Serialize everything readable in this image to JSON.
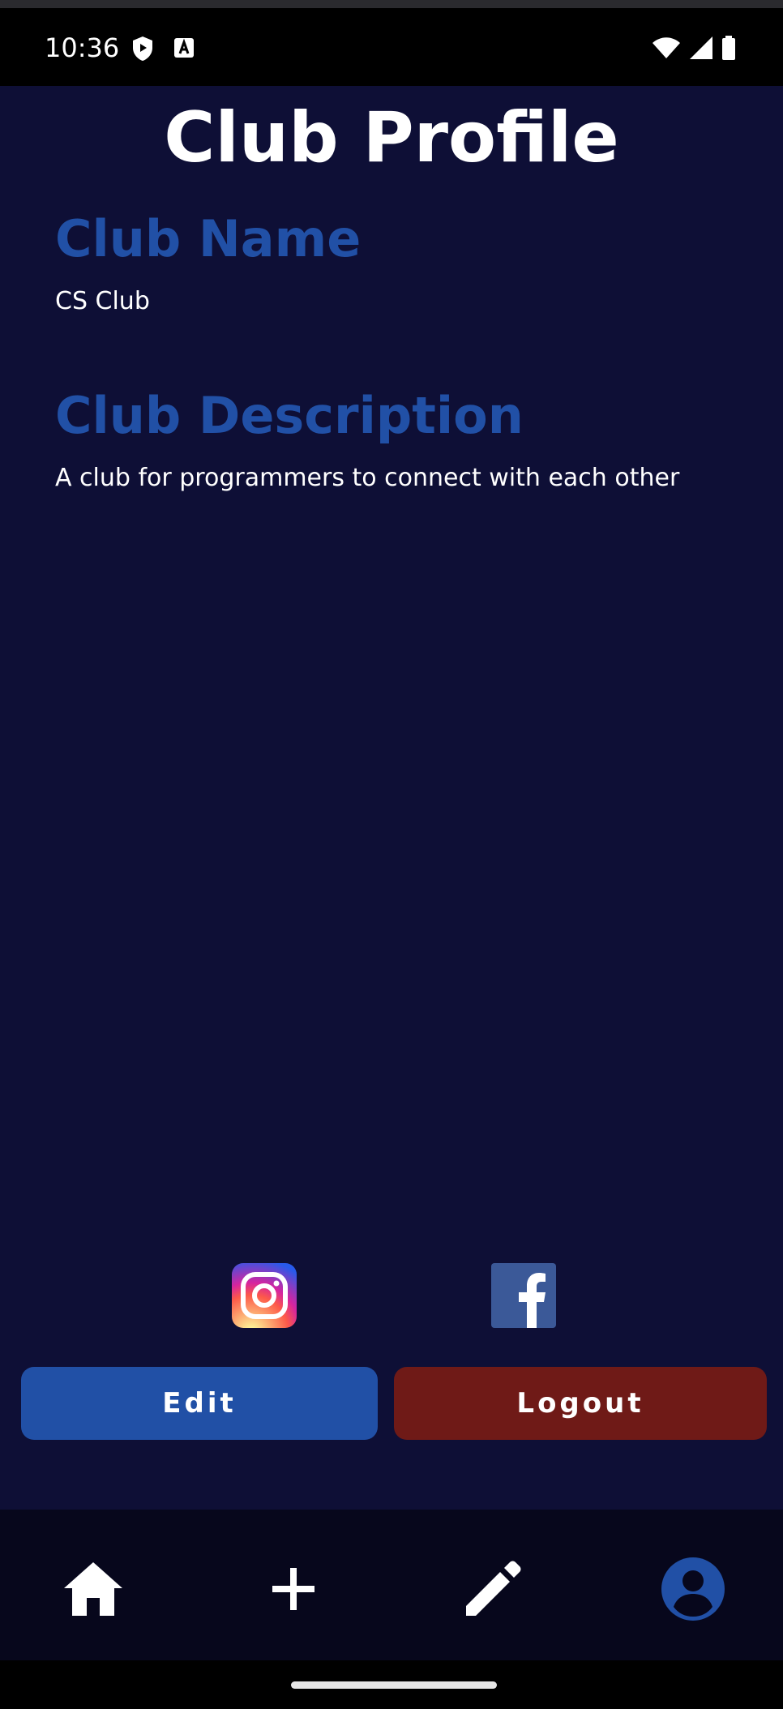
{
  "status_bar": {
    "time": "10:36",
    "icons": [
      "shield-icon",
      "a-box-icon",
      "wifi-icon",
      "signal-icon",
      "battery-icon"
    ]
  },
  "page": {
    "title": "Club Profile"
  },
  "club": {
    "name_heading": "Club Name",
    "name_value": "CS Club",
    "description_heading": "Club Description",
    "description_value": "A club for programmers to connect with each other"
  },
  "social": {
    "icons": [
      "instagram-icon",
      "facebook-icon"
    ]
  },
  "actions": {
    "edit_label": "Edit",
    "logout_label": "Logout"
  },
  "bottom_nav": {
    "items": [
      {
        "icon": "home-icon",
        "active": false
      },
      {
        "icon": "plus-icon",
        "active": false
      },
      {
        "icon": "pencil-icon",
        "active": false
      },
      {
        "icon": "account-icon",
        "active": true
      }
    ]
  },
  "colors": {
    "background": "#0e0f36",
    "accent_blue": "#2150a6",
    "logout_red": "#6f1a17",
    "nav_background": "#07071c"
  }
}
